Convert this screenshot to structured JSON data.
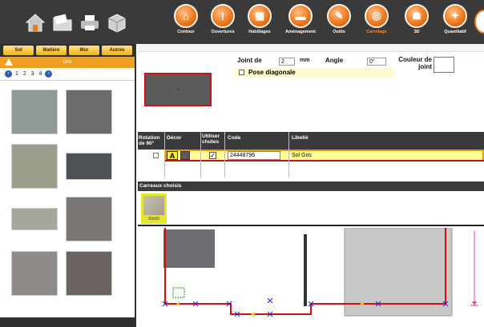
{
  "toolbar": {
    "quick_icons": [
      "home-icon",
      "folder-icon",
      "print-icon",
      "box-icon"
    ],
    "tools": [
      {
        "label": "Contour",
        "icon": "contour-icon",
        "glyph": "⌂"
      },
      {
        "label": "Ouvertures",
        "icon": "opening-icon",
        "glyph": "!"
      },
      {
        "label": "Habillages",
        "icon": "dressing-icon",
        "glyph": "▦"
      },
      {
        "label": "Aménagement",
        "icon": "furnishing-icon",
        "glyph": "▬"
      },
      {
        "label": "Outils",
        "icon": "tools-icon",
        "glyph": "✎"
      },
      {
        "label": "Carrelage",
        "icon": "tiling-icon",
        "glyph": "◎"
      },
      {
        "label": "3D",
        "icon": "3d-icon",
        "glyph": "☗"
      },
      {
        "label": "Quantitatif",
        "icon": "quantity-icon",
        "glyph": "✦"
      }
    ],
    "active_tool": "Carrelage"
  },
  "left_panel": {
    "tabs": [
      "Sol",
      "Matière",
      "Mur",
      "Autres"
    ],
    "crumb": "Gris",
    "pages": [
      "1",
      "2",
      "3",
      "4"
    ],
    "swatch_colors": [
      "#8f9a98",
      "#6c6d6a",
      "#9c9e8c",
      "#4e5254",
      "#a6a79a",
      "#7a7775",
      "#8e8b88",
      "#6a6360"
    ]
  },
  "settings": {
    "joint_label": "Joint de",
    "joint_value": "2",
    "joint_unit": "mm",
    "angle_label": "Angle",
    "angle_value": "0°",
    "couleur_label_1": "Couleur de",
    "couleur_label_2": "joint",
    "diagonal_label": "Pose diagonale",
    "preview_caption": "A"
  },
  "table": {
    "headers": {
      "rotation": "Rotation de 90°",
      "decor": "Décor",
      "chutes": "Utiliser chutes",
      "code": "Code",
      "libelle": "Libellé"
    },
    "row": {
      "decor_letter": "A",
      "code": "24448796",
      "libelle": "Sol Gris"
    }
  },
  "chosen": {
    "title": "Carreaux choisis",
    "tile_caption": "50x50"
  },
  "colors": {
    "accent_orange": "#f07a1e",
    "wall_red": "#d01010",
    "highlight_yellow": "#ffff99",
    "dark_bar": "#3a3a3a"
  }
}
